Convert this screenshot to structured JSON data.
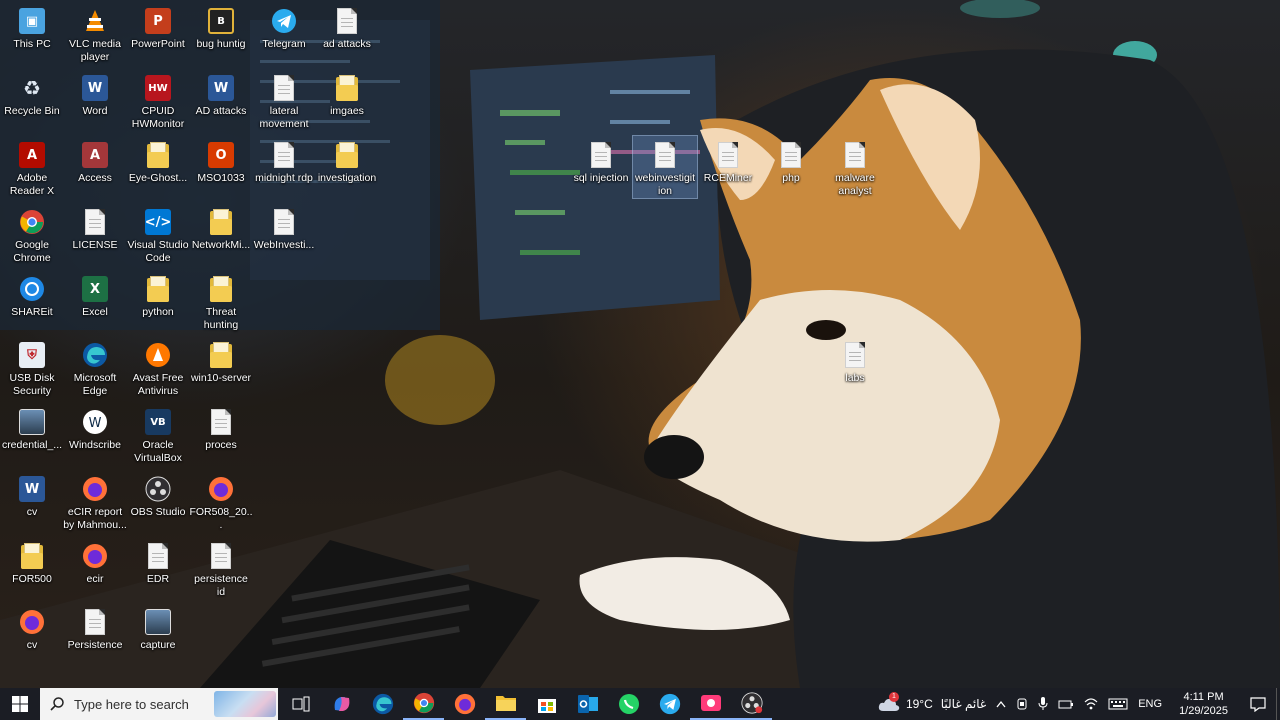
{
  "desktop": {
    "icons": [
      {
        "id": "this-pc",
        "label": "This PC",
        "kind": "pc"
      },
      {
        "id": "vlc",
        "label": "VLC media player",
        "kind": "vlc"
      },
      {
        "id": "powerpoint",
        "label": "PowerPoint",
        "kind": "ppt"
      },
      {
        "id": "bug-huntig",
        "label": "bug huntig",
        "kind": "book"
      },
      {
        "id": "telegram",
        "label": "Telegram",
        "kind": "telegram"
      },
      {
        "id": "ad-attacks",
        "label": "ad attacks",
        "kind": "doc"
      },
      {
        "id": "recycle-bin",
        "label": "Recycle Bin",
        "kind": "bin"
      },
      {
        "id": "word",
        "label": "Word",
        "kind": "word"
      },
      {
        "id": "cpuid",
        "label": "CPUID HWMonitor",
        "kind": "cpuid"
      },
      {
        "id": "ad-attacks-doc",
        "label": "AD attacks",
        "kind": "word"
      },
      {
        "id": "lateral-movement",
        "label": "lateral movement",
        "kind": "doc"
      },
      {
        "id": "imgaes",
        "label": "imgaes",
        "kind": "folder"
      },
      {
        "id": "adobe-reader",
        "label": "Adobe Reader X",
        "kind": "pdf"
      },
      {
        "id": "access",
        "label": "Access",
        "kind": "access"
      },
      {
        "id": "eye-ghost",
        "label": "Eye-Ghost...",
        "kind": "folder"
      },
      {
        "id": "mso1033",
        "label": "MSO1033",
        "kind": "office"
      },
      {
        "id": "midnight-rdp",
        "label": "midnight rdp",
        "kind": "doc"
      },
      {
        "id": "investigation",
        "label": "investigation",
        "kind": "folder"
      },
      {
        "id": "google-chrome",
        "label": "Google Chrome",
        "kind": "chrome"
      },
      {
        "id": "license",
        "label": "LICENSE",
        "kind": "doc"
      },
      {
        "id": "vscode",
        "label": "Visual Studio Code",
        "kind": "vscode"
      },
      {
        "id": "networkmi",
        "label": "NetworkMi...",
        "kind": "folder"
      },
      {
        "id": "webinvesti",
        "label": "WebInvesti...",
        "kind": "doc"
      },
      {
        "id": "shareit",
        "label": "SHAREit",
        "kind": "shareit"
      },
      {
        "id": "excel",
        "label": "Excel",
        "kind": "excel"
      },
      {
        "id": "python",
        "label": "python",
        "kind": "folder"
      },
      {
        "id": "threat-hunting",
        "label": "Threat hunting",
        "kind": "folder"
      },
      {
        "id": "usb-disk-security",
        "label": "USB Disk Security",
        "kind": "usb"
      },
      {
        "id": "edge",
        "label": "Microsoft Edge",
        "kind": "edge"
      },
      {
        "id": "avast",
        "label": "Avast Free Antivirus",
        "kind": "avast"
      },
      {
        "id": "win10-server",
        "label": "win10-server",
        "kind": "folder"
      },
      {
        "id": "credential",
        "label": "credential_...",
        "kind": "image"
      },
      {
        "id": "windscribe",
        "label": "Windscribe",
        "kind": "windscribe"
      },
      {
        "id": "virtualbox",
        "label": "Oracle VirtualBox",
        "kind": "vbox"
      },
      {
        "id": "proces",
        "label": "proces",
        "kind": "doc"
      },
      {
        "id": "cv-word",
        "label": "cv",
        "kind": "word"
      },
      {
        "id": "ecir-report",
        "label": "eCIR report by Mahmou...",
        "kind": "firefox"
      },
      {
        "id": "obs",
        "label": "OBS Studio",
        "kind": "obs"
      },
      {
        "id": "for508",
        "label": "FOR508_20...",
        "kind": "firefox"
      },
      {
        "id": "for500",
        "label": "FOR500",
        "kind": "folder"
      },
      {
        "id": "ecir",
        "label": "ecir",
        "kind": "firefox"
      },
      {
        "id": "edr",
        "label": "EDR",
        "kind": "doc"
      },
      {
        "id": "persistence-id",
        "label": "persistence id",
        "kind": "doc"
      },
      {
        "id": "cv-firefox",
        "label": "cv",
        "kind": "firefox"
      },
      {
        "id": "persistence",
        "label": "Persistence",
        "kind": "doc"
      },
      {
        "id": "capture",
        "label": "capture",
        "kind": "image"
      },
      {
        "id": "sql-injection",
        "label": "sql injection",
        "kind": "doc"
      },
      {
        "id": "webinvestigation",
        "label": "webinvestigit ion",
        "kind": "doc"
      },
      {
        "id": "rceminer",
        "label": "RCEMiner",
        "kind": "doc"
      },
      {
        "id": "php",
        "label": "php",
        "kind": "doc"
      },
      {
        "id": "malware-analyst",
        "label": "malware analyst",
        "kind": "doc"
      },
      {
        "id": "labs",
        "label": "labs",
        "kind": "doc"
      }
    ]
  },
  "taskbar": {
    "search_placeholder": "Type here to search",
    "apps": [
      {
        "id": "task-view",
        "icon": "task-view-icon"
      },
      {
        "id": "copilot",
        "icon": "copilot-icon"
      },
      {
        "id": "edge",
        "icon": "edge-icon"
      },
      {
        "id": "chrome",
        "icon": "chrome-icon"
      },
      {
        "id": "firefox",
        "icon": "firefox-icon"
      },
      {
        "id": "file-explorer",
        "icon": "folder-icon"
      },
      {
        "id": "store",
        "icon": "store-icon"
      },
      {
        "id": "outlook",
        "icon": "outlook-icon"
      },
      {
        "id": "whatsapp",
        "icon": "whatsapp-icon"
      },
      {
        "id": "telegram",
        "icon": "telegram-icon"
      },
      {
        "id": "screen-recorder",
        "icon": "recorder-icon"
      },
      {
        "id": "obs",
        "icon": "obs-icon"
      }
    ],
    "weather": {
      "temp": "19°C",
      "condition": "غائم غالبًا",
      "badge": "1"
    },
    "language": "ENG",
    "clock": {
      "time": "4:11 PM",
      "date": "1/29/2025"
    }
  },
  "colors": {
    "taskbar": "#1b1d24",
    "accent": "#8ab4f8",
    "search_bg": "#f3f3f3"
  }
}
